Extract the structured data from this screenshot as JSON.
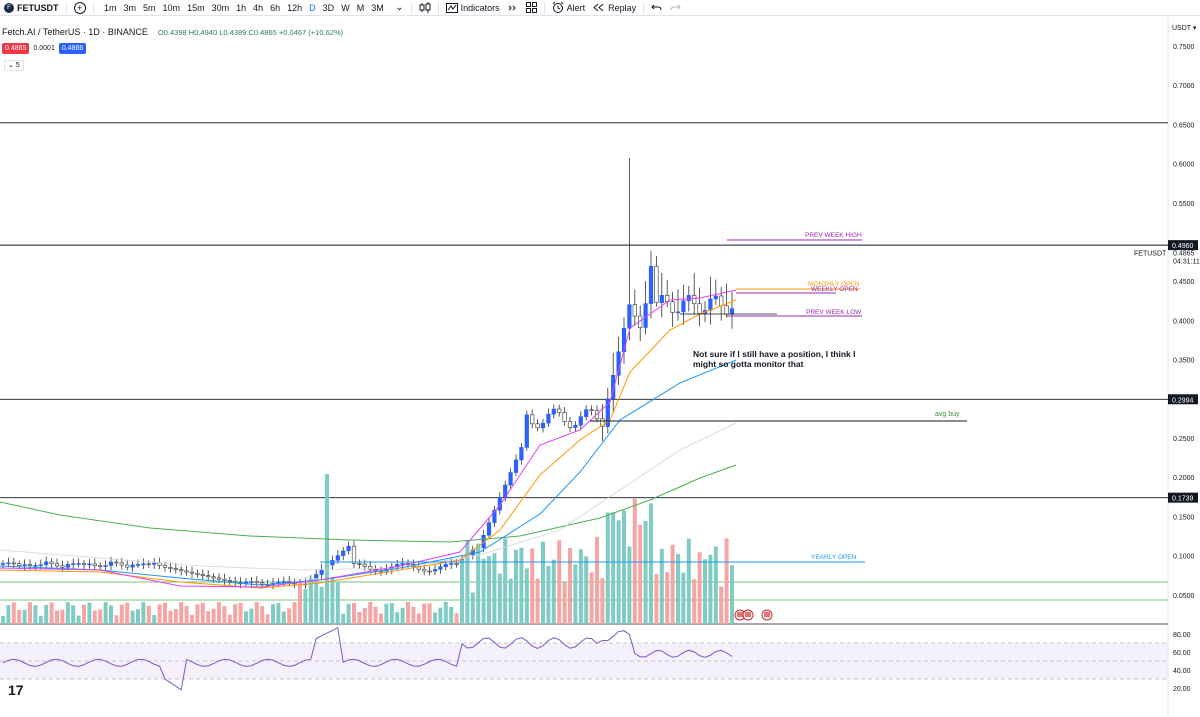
{
  "toolbar": {
    "symbol": "FETUSDT",
    "symbol_logo": "F",
    "add_symbol_icon": "+",
    "timeframes": [
      "1m",
      "3m",
      "5m",
      "10m",
      "15m",
      "30m",
      "1h",
      "4h",
      "6h",
      "12h",
      "D",
      "3D",
      "W",
      "M",
      "3M"
    ],
    "active_timeframe": "D",
    "chevron": "⌄",
    "candles_icon": "candles-icon",
    "indicators_label": "Indicators",
    "alert_label": "Alert",
    "replay_label": "Replay"
  },
  "legend": {
    "title": "Fetch.AI / TetherUS · 1D · BINANCE",
    "open": "O0.4398",
    "high": "H0.4940",
    "low": "L0.4389",
    "close": "C0.4865",
    "change": "+0.0467 (+10.62%)",
    "sell_price": "0.4865",
    "spread": "0.0001",
    "buy_price": "0.4866",
    "indicator_count": "5"
  },
  "scale": {
    "currency": "USDT",
    "ticks": [
      {
        "label": "0.7500",
        "value": 0.75
      },
      {
        "label": "0.7000",
        "value": 0.7
      },
      {
        "label": "0.6500",
        "value": 0.65
      },
      {
        "label": "0.6000",
        "value": 0.6
      },
      {
        "label": "0.5500",
        "value": 0.55
      },
      {
        "label": "0.4500",
        "value": 0.45
      },
      {
        "label": "0.4000",
        "value": 0.4
      },
      {
        "label": "0.3500",
        "value": 0.35
      },
      {
        "label": "0.2500",
        "value": 0.25
      },
      {
        "label": "0.2000",
        "value": 0.2
      },
      {
        "label": "0.1500",
        "value": 0.15
      },
      {
        "label": "0.1000",
        "value": 0.1
      },
      {
        "label": "0.0500",
        "value": 0.05
      }
    ],
    "highlighted": [
      {
        "label": "0.4960",
        "value": 0.496
      },
      {
        "label": "0.2994",
        "value": 0.2994
      },
      {
        "label": "0.1739",
        "value": 0.1739
      }
    ],
    "last_symbol": "FETUSDT",
    "last_price": "0.4865",
    "countdown": "04:31:11",
    "rsi_ticks": [
      {
        "label": "80.00",
        "value": 80
      },
      {
        "label": "60.00",
        "value": 60
      },
      {
        "label": "40.00",
        "value": 40
      },
      {
        "label": "20.00",
        "value": 20
      }
    ]
  },
  "annotations": {
    "prev_week_high": "PREV WEEK HIGH",
    "monthly_open": "MONTHLY OPEN",
    "weekly_open": "WEEKLY OPEN",
    "prev_week_low": "PREV WEEK LOW",
    "note_line1": "Not sure if I still have a position, I think I",
    "note_line2": "might so gotta monitor that",
    "avg_buy": "avg buy",
    "yearly_open": "YEARLY OPEN"
  },
  "colors": {
    "up": "#26a69a",
    "down": "#ef5350",
    "candle_up": "#2962ff",
    "ema_pink": "#e040fb",
    "ema_orange": "#ff9800",
    "ema_blue": "#2196f3",
    "ema_green": "#4caf50",
    "rsi": "#7e57c2",
    "annotation_purple": "#9c27b0",
    "annotation_orange": "#ff9800",
    "annotation_green": "#388e3c",
    "annotation_blue": "#2196f3"
  },
  "branding": {
    "logo": "17"
  }
}
